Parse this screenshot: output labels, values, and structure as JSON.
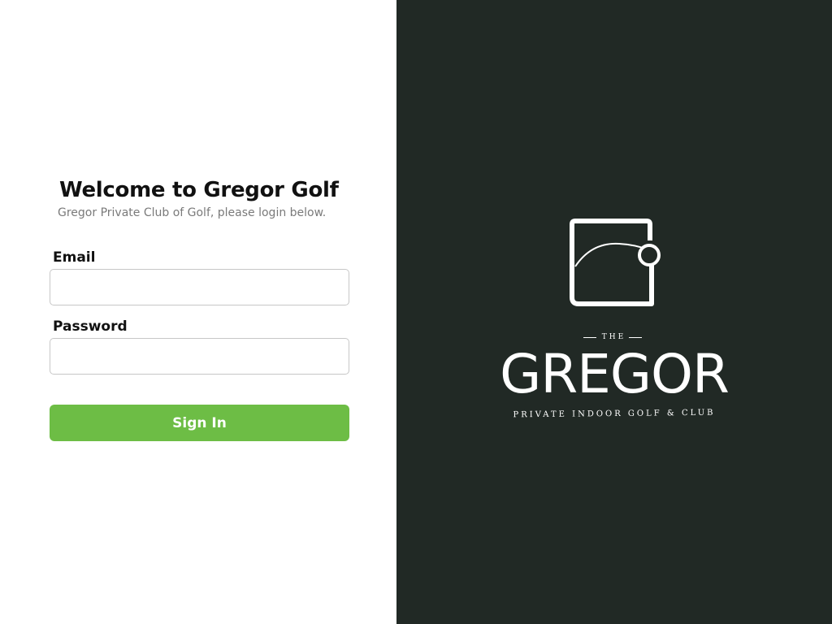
{
  "login": {
    "title": "Welcome to Gregor Golf",
    "subtitle": "Gregor Private Club of Golf, please login below.",
    "email_label": "Email",
    "email_value": "",
    "password_label": "Password",
    "password_value": "",
    "signin_label": "Sign In"
  },
  "brand": {
    "the": "THE",
    "name": "GREGOR",
    "tagline": "PRIVATE INDOOR GOLF & CLUB",
    "logo_icon": "golf-ball-tee-logo-icon"
  },
  "colors": {
    "brand_panel": "#212925",
    "accent_green": "#6dbd45",
    "text_dark": "#111111",
    "text_muted": "#7a7a7a"
  }
}
